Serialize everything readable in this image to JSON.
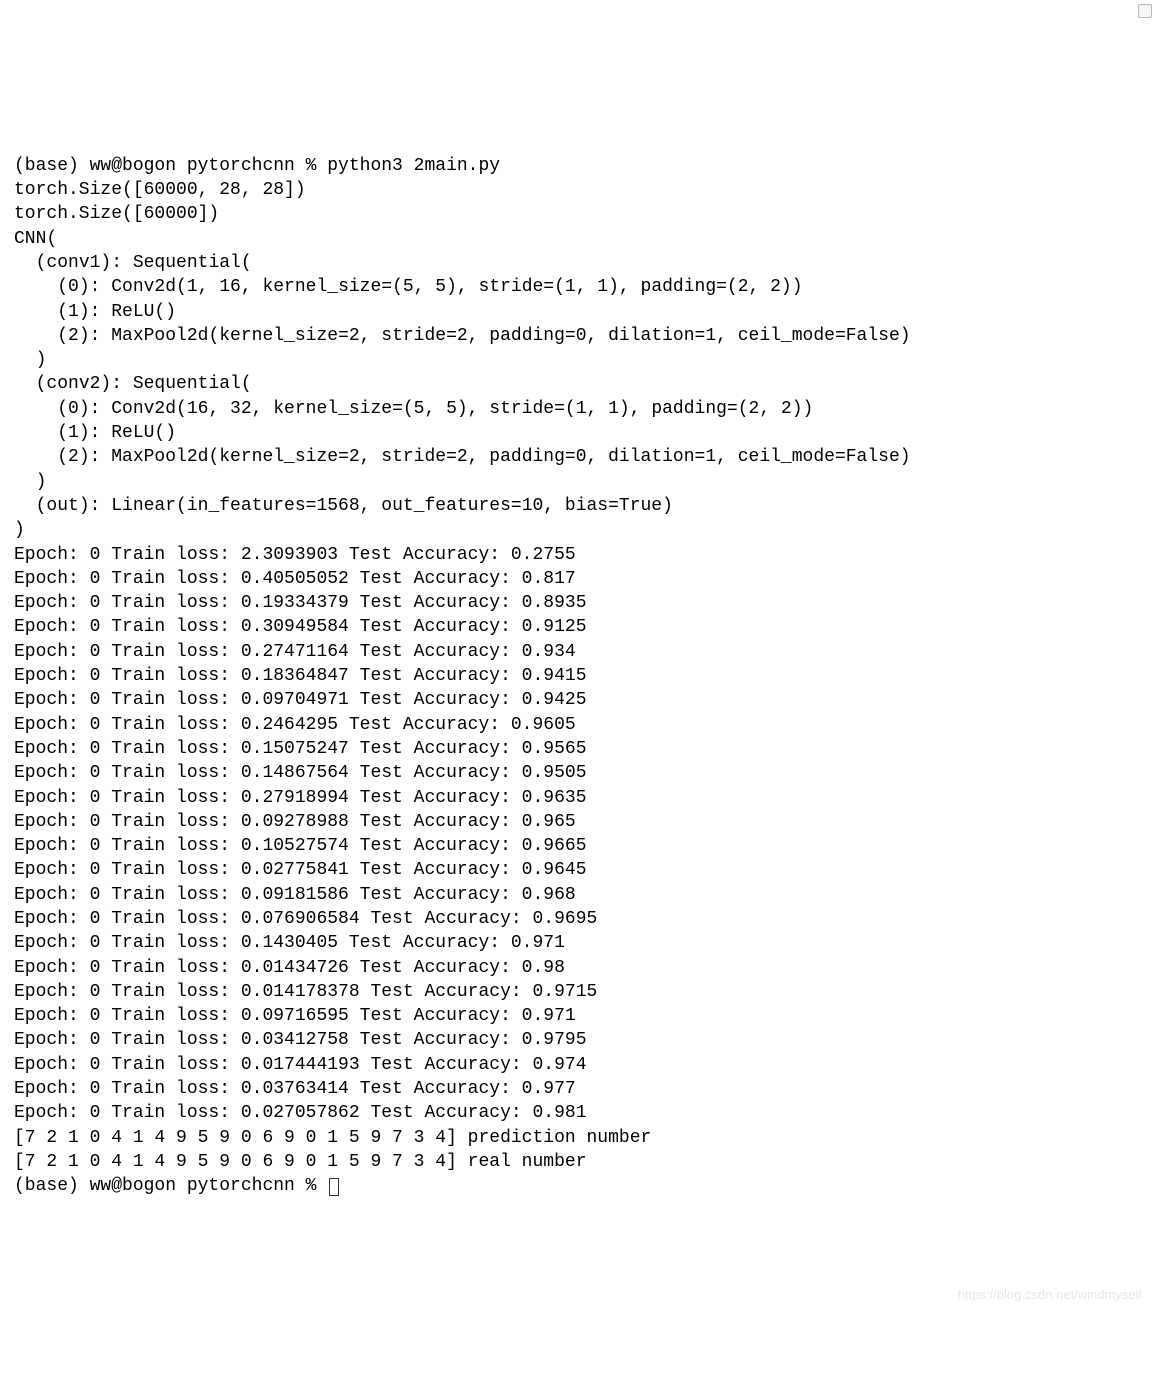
{
  "terminal": {
    "prompt1": "(base) ww@bogon pytorchcnn % python3 2main.py",
    "model_lines": [
      "torch.Size([60000, 28, 28])",
      "torch.Size([60000])",
      "CNN(",
      "  (conv1): Sequential(",
      "    (0): Conv2d(1, 16, kernel_size=(5, 5), stride=(1, 1), padding=(2, 2))",
      "    (1): ReLU()",
      "    (2): MaxPool2d(kernel_size=2, stride=2, padding=0, dilation=1, ceil_mode=False)",
      "  )",
      "  (conv2): Sequential(",
      "    (0): Conv2d(16, 32, kernel_size=(5, 5), stride=(1, 1), padding=(2, 2))",
      "    (1): ReLU()",
      "    (2): MaxPool2d(kernel_size=2, stride=2, padding=0, dilation=1, ceil_mode=False)",
      "  )",
      "  (out): Linear(in_features=1568, out_features=10, bias=True)",
      ")"
    ],
    "training": [
      {
        "epoch": 0,
        "loss": "2.3093903",
        "acc": "0.2755"
      },
      {
        "epoch": 0,
        "loss": "0.40505052",
        "acc": "0.817"
      },
      {
        "epoch": 0,
        "loss": "0.19334379",
        "acc": "0.8935"
      },
      {
        "epoch": 0,
        "loss": "0.30949584",
        "acc": "0.9125"
      },
      {
        "epoch": 0,
        "loss": "0.27471164",
        "acc": "0.934"
      },
      {
        "epoch": 0,
        "loss": "0.18364847",
        "acc": "0.9415"
      },
      {
        "epoch": 0,
        "loss": "0.09704971",
        "acc": "0.9425"
      },
      {
        "epoch": 0,
        "loss": "0.2464295",
        "acc": "0.9605"
      },
      {
        "epoch": 0,
        "loss": "0.15075247",
        "acc": "0.9565"
      },
      {
        "epoch": 0,
        "loss": "0.14867564",
        "acc": "0.9505"
      },
      {
        "epoch": 0,
        "loss": "0.27918994",
        "acc": "0.9635"
      },
      {
        "epoch": 0,
        "loss": "0.09278988",
        "acc": "0.965"
      },
      {
        "epoch": 0,
        "loss": "0.10527574",
        "acc": "0.9665"
      },
      {
        "epoch": 0,
        "loss": "0.02775841",
        "acc": "0.9645"
      },
      {
        "epoch": 0,
        "loss": "0.09181586",
        "acc": "0.968"
      },
      {
        "epoch": 0,
        "loss": "0.076906584",
        "acc": "0.9695"
      },
      {
        "epoch": 0,
        "loss": "0.1430405",
        "acc": "0.971"
      },
      {
        "epoch": 0,
        "loss": "0.01434726",
        "acc": "0.98"
      },
      {
        "epoch": 0,
        "loss": "0.014178378",
        "acc": "0.9715"
      },
      {
        "epoch": 0,
        "loss": "0.09716595",
        "acc": "0.971"
      },
      {
        "epoch": 0,
        "loss": "0.03412758",
        "acc": "0.9795"
      },
      {
        "epoch": 0,
        "loss": "0.017444193",
        "acc": "0.974"
      },
      {
        "epoch": 0,
        "loss": "0.03763414",
        "acc": "0.977"
      },
      {
        "epoch": 0,
        "loss": "0.027057862",
        "acc": "0.981"
      }
    ],
    "prediction_line": "[7 2 1 0 4 1 4 9 5 9 0 6 9 0 1 5 9 7 3 4] prediction number",
    "real_line": "[7 2 1 0 4 1 4 9 5 9 0 6 9 0 1 5 9 7 3 4] real number",
    "prompt2": "(base) ww@bogon pytorchcnn % "
  },
  "watermark": "https://blog.csdn.net/windmyself"
}
